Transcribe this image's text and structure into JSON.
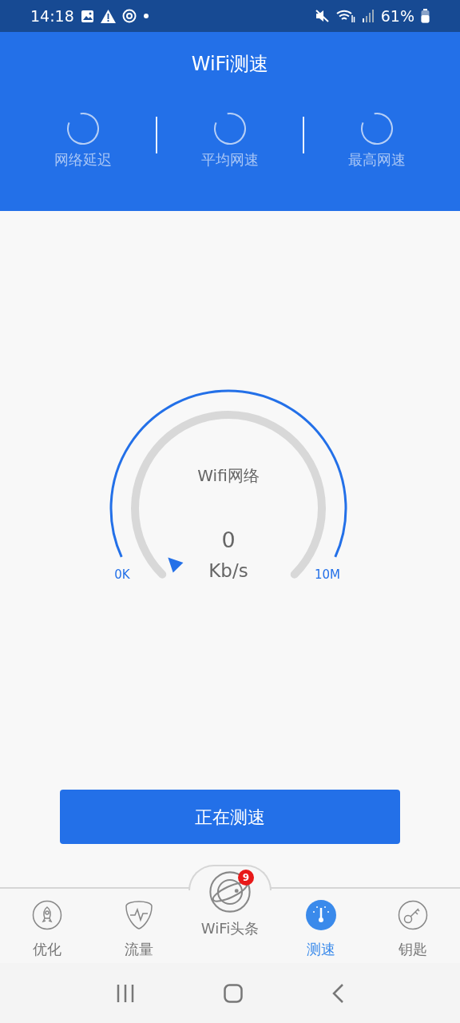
{
  "status_bar": {
    "time": "14:18",
    "battery": "61%"
  },
  "header": {
    "title": "WiFi测速",
    "metrics": [
      {
        "label": "网络延迟"
      },
      {
        "label": "平均网速"
      },
      {
        "label": "最高网速"
      }
    ]
  },
  "gauge": {
    "title": "Wifi网络",
    "value": "0",
    "unit": "Kb/s",
    "min_label": "0K",
    "max_label": "10M"
  },
  "action_button": {
    "label": "正在测速"
  },
  "bottom_nav": [
    {
      "label": "优化",
      "kind": "rocket",
      "selected": false
    },
    {
      "label": "流量",
      "kind": "pulse",
      "selected": false
    },
    {
      "label": "WiFi头条",
      "kind": "planet",
      "selected": false,
      "badge": "9"
    },
    {
      "label": "测速",
      "kind": "speedometer",
      "selected": true
    },
    {
      "label": "钥匙",
      "kind": "key",
      "selected": false
    }
  ]
}
